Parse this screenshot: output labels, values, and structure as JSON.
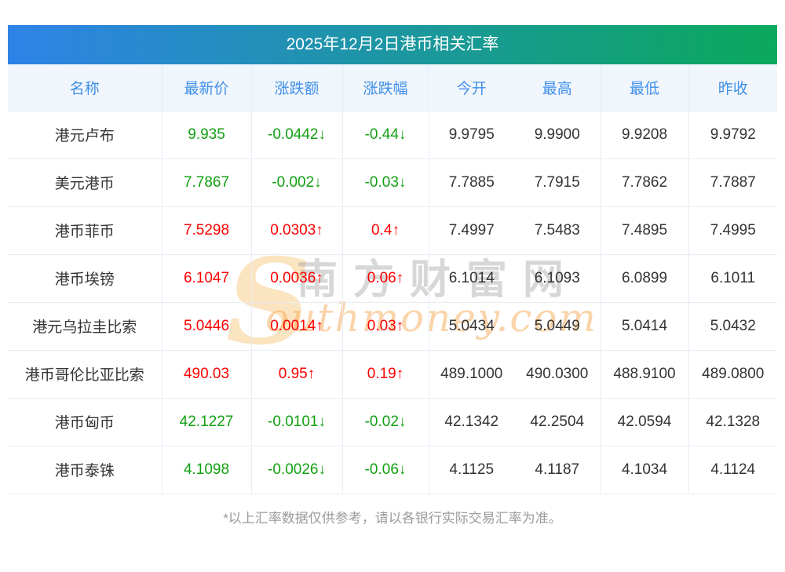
{
  "title_bar": {
    "gradient_left": "#2e83e7",
    "gradient_right": "#0ba95c"
  },
  "chart_data": {
    "type": "table",
    "title": "2025年12月2日港币相关汇率",
    "columns": [
      "名称",
      "最新价",
      "涨跌额",
      "涨跌幅",
      "今开",
      "最高",
      "最低",
      "昨收"
    ],
    "rows": [
      {
        "name": "港元卢布",
        "last": "9.935",
        "change": "-0.0442↓",
        "change_pct": "-0.44↓",
        "open": "9.9795",
        "high": "9.9900",
        "low": "9.9208",
        "prev_close": "9.9792",
        "direction": "down"
      },
      {
        "name": "美元港币",
        "last": "7.7867",
        "change": "-0.002↓",
        "change_pct": "-0.03↓",
        "open": "7.7885",
        "high": "7.7915",
        "low": "7.7862",
        "prev_close": "7.7887",
        "direction": "down"
      },
      {
        "name": "港币菲币",
        "last": "7.5298",
        "change": "0.0303↑",
        "change_pct": "0.4↑",
        "open": "7.4997",
        "high": "7.5483",
        "low": "7.4895",
        "prev_close": "7.4995",
        "direction": "up"
      },
      {
        "name": "港币埃镑",
        "last": "6.1047",
        "change": "0.0036↑",
        "change_pct": "0.06↑",
        "open": "6.1014",
        "high": "6.1093",
        "low": "6.0899",
        "prev_close": "6.1011",
        "direction": "up"
      },
      {
        "name": "港元乌拉圭比索",
        "last": "5.0446",
        "change": "0.0014↑",
        "change_pct": "0.03↑",
        "open": "5.0434",
        "high": "5.0449",
        "low": "5.0414",
        "prev_close": "5.0432",
        "direction": "up"
      },
      {
        "name": "港币哥伦比亚比索",
        "last": "490.03",
        "change": "0.95↑",
        "change_pct": "0.19↑",
        "open": "489.1000",
        "high": "490.0300",
        "low": "488.9100",
        "prev_close": "489.0800",
        "direction": "up"
      },
      {
        "name": "港币匈币",
        "last": "42.1227",
        "change": "-0.0101↓",
        "change_pct": "-0.02↓",
        "open": "42.1342",
        "high": "42.2504",
        "low": "42.0594",
        "prev_close": "42.1328",
        "direction": "down"
      },
      {
        "name": "港币泰铢",
        "last": "4.1098",
        "change": "-0.0026↓",
        "change_pct": "-0.06↓",
        "open": "4.1125",
        "high": "4.1187",
        "low": "4.1034",
        "prev_close": "4.1124",
        "direction": "down"
      }
    ],
    "colors": {
      "up": "#fe0101",
      "down": "#12a012",
      "header_text": "#3f90e8",
      "header_bg": "#f1f6fd",
      "body_text": "#333333",
      "grid_line": "#e7edf4"
    },
    "legend_position": "none",
    "grid": true
  },
  "watermark": {
    "initial": "S",
    "cn_text": "南方财富网",
    "en_text": "outhmoney.com"
  },
  "footer": {
    "note": "*以上汇率数据仅供参考，请以各银行实际交易汇率为准。"
  }
}
